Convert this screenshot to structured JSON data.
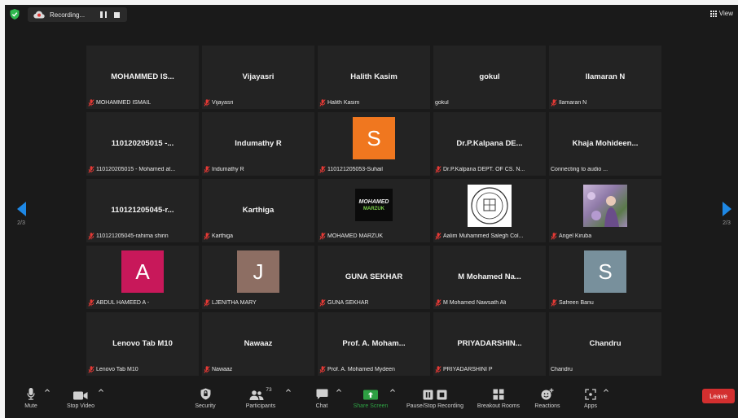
{
  "topbar": {
    "recording_text": "Recording...",
    "view_label": "View"
  },
  "nav": {
    "left_page": "2/3",
    "right_page": "2/3",
    "arrow_color": "#1e88e5"
  },
  "participants": [
    {
      "big": "MOHAMMED  IS...",
      "name": "MOHAMMED ISMAIL",
      "muted": true
    },
    {
      "big": "Vijayasri",
      "name": "Vijayasri",
      "muted": true
    },
    {
      "big": "Halith Kasim",
      "name": "Halith Kasim",
      "muted": true
    },
    {
      "big": "gokul",
      "name": "gokul",
      "muted": false
    },
    {
      "big": "Ilamaran N",
      "name": "Ilamaran N",
      "muted": true
    },
    {
      "big": "110120205015 -...",
      "name": "110120205015 - Mohamed at...",
      "muted": true
    },
    {
      "big": "Indumathy R",
      "name": "Indumathy R",
      "muted": true
    },
    {
      "avatar": "S",
      "avatar_color": "#f0771f",
      "name": "110121205053-Suhail",
      "muted": true
    },
    {
      "big": "Dr.P.Kalpana  DE...",
      "name": "Dr.P.Kalpana DEPT. OF CS. N...",
      "muted": true
    },
    {
      "big": "Khaja  Mohideen...",
      "name": "Connecting to audio ...",
      "muted": false
    },
    {
      "big": "110121205045-r...",
      "name": "110121205045-rahima shirin",
      "muted": true
    },
    {
      "big": "Karthiga",
      "name": "Karthiga",
      "muted": true
    },
    {
      "image": "logo",
      "logo_text_top": "MOHAMED",
      "logo_text_bottom": "MARZUK",
      "name": "MOHAMED MARZUK",
      "muted": true
    },
    {
      "image": "emblem",
      "name": "Aalim Muhammed Salegh Col...",
      "muted": true
    },
    {
      "image": "photo",
      "name": "Angel Kiruba",
      "muted": true
    },
    {
      "avatar": "A",
      "avatar_color": "#c8185a",
      "name": "ABDUL HAMEED A -",
      "muted": true
    },
    {
      "avatar": "J",
      "avatar_color": "#8d6e63",
      "name": "LJENITHA MARY",
      "muted": true
    },
    {
      "big": "GUNA SEKHAR",
      "name": "GUNA SEKHAR",
      "muted": true
    },
    {
      "big": "M Mohamed  Na...",
      "name": "M Mohamed Nawsath Ali",
      "muted": true
    },
    {
      "avatar": "S",
      "avatar_color": "#78909c",
      "name": "Safreen Banu",
      "muted": true
    },
    {
      "big": "Lenovo Tab M10",
      "name": "Lenovo Tab M10",
      "muted": true
    },
    {
      "big": "Nawaaz",
      "name": "Nawaaz",
      "muted": true
    },
    {
      "big": "Prof. A. Moham...",
      "name": "Prof. A. Mohamed Mydeen",
      "muted": true
    },
    {
      "big": "PRIYADARSHIN...",
      "name": "PRIYADARSHINI P",
      "muted": true
    },
    {
      "big": "Chandru",
      "name": "Chandru",
      "muted": false
    }
  ],
  "toolbar": {
    "mute": "Mute",
    "stop_video": "Stop Video",
    "security": "Security",
    "participants": "Participants",
    "participant_count": "73",
    "chat": "Chat",
    "share_screen": "Share Screen",
    "pause_stop_recording": "Pause/Stop Recording",
    "breakout_rooms": "Breakout Rooms",
    "reactions": "Reactions",
    "apps": "Apps",
    "leave": "Leave",
    "share_color": "#2ea043",
    "leave_color": "#d32f2f"
  }
}
